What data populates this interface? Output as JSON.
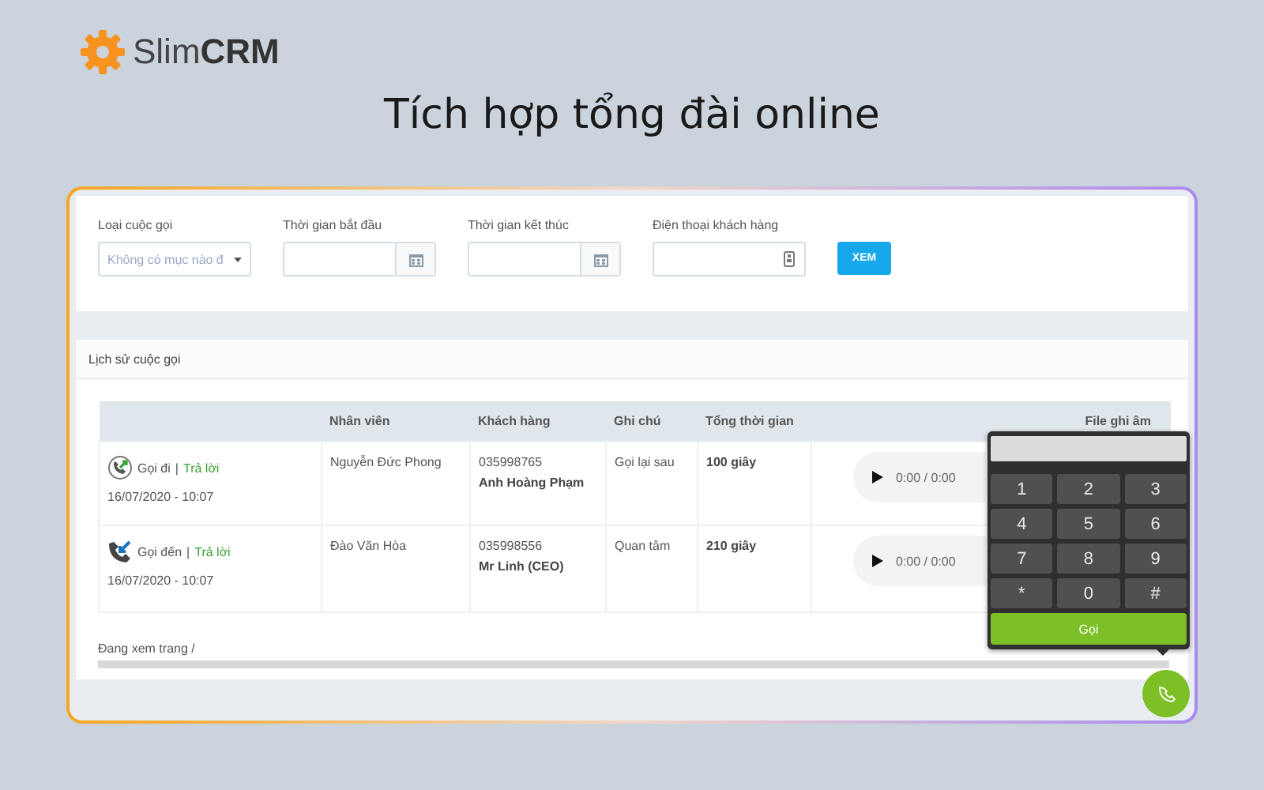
{
  "logo": {
    "text": "Slim**CRM**"
  },
  "headline": "Tích hợp tổng đài online",
  "filters": [
    {
      "kind": "select",
      "label": "Loại cuộc gọi",
      "placeholder": "Không có mục nào đ"
    },
    {
      "kind": "date",
      "label": "Thời gian bắt đầu"
    },
    {
      "kind": "date",
      "label": "Thời gian kết thúc"
    },
    {
      "kind": "phone",
      "label": "Điện thoại khách hàng"
    }
  ],
  "search_button": "XEM",
  "history": {
    "title": "Lịch sử cuộc gọi",
    "columns": [
      {
        "label": "Nhân viên"
      },
      {
        "label": "Khách hàng"
      },
      {
        "label": "Ghi chú"
      },
      {
        "label": "Tổng thời gian"
      },
      {
        "label": "File ghi âm"
      }
    ],
    "rows": [
      {
        "kind": "outgoing",
        "call_type": "Gọi đi",
        "separator": "|",
        "status": "Trả lời",
        "time": "16/07/2020 - 10:07",
        "staff": "Nguyễn Đức Phong",
        "phone": "035998765",
        "customer": "Anh Hoàng Phạm",
        "note": "Gọi lại sau",
        "duration": "100 giây",
        "audio_time": "0:00 / 0:00"
      },
      {
        "kind": "incoming",
        "call_type": "Gọi đến",
        "separator": "|",
        "status": "Trả lời",
        "time": "16/07/2020 - 10:07",
        "staff": "Đào Văn Hòa",
        "phone": "035998556",
        "customer": "Mr Linh (CEO)",
        "note": "Quan tâm",
        "duration": "210 giây",
        "audio_time": "0:00 / 0:00"
      }
    ],
    "pager": "Đang xem trang /"
  },
  "dialpad": {
    "keys": [
      "1",
      "2",
      "3",
      "4",
      "5",
      "6",
      "7",
      "8",
      "9",
      "*",
      "0",
      "#"
    ],
    "call_button": "Gọi"
  }
}
